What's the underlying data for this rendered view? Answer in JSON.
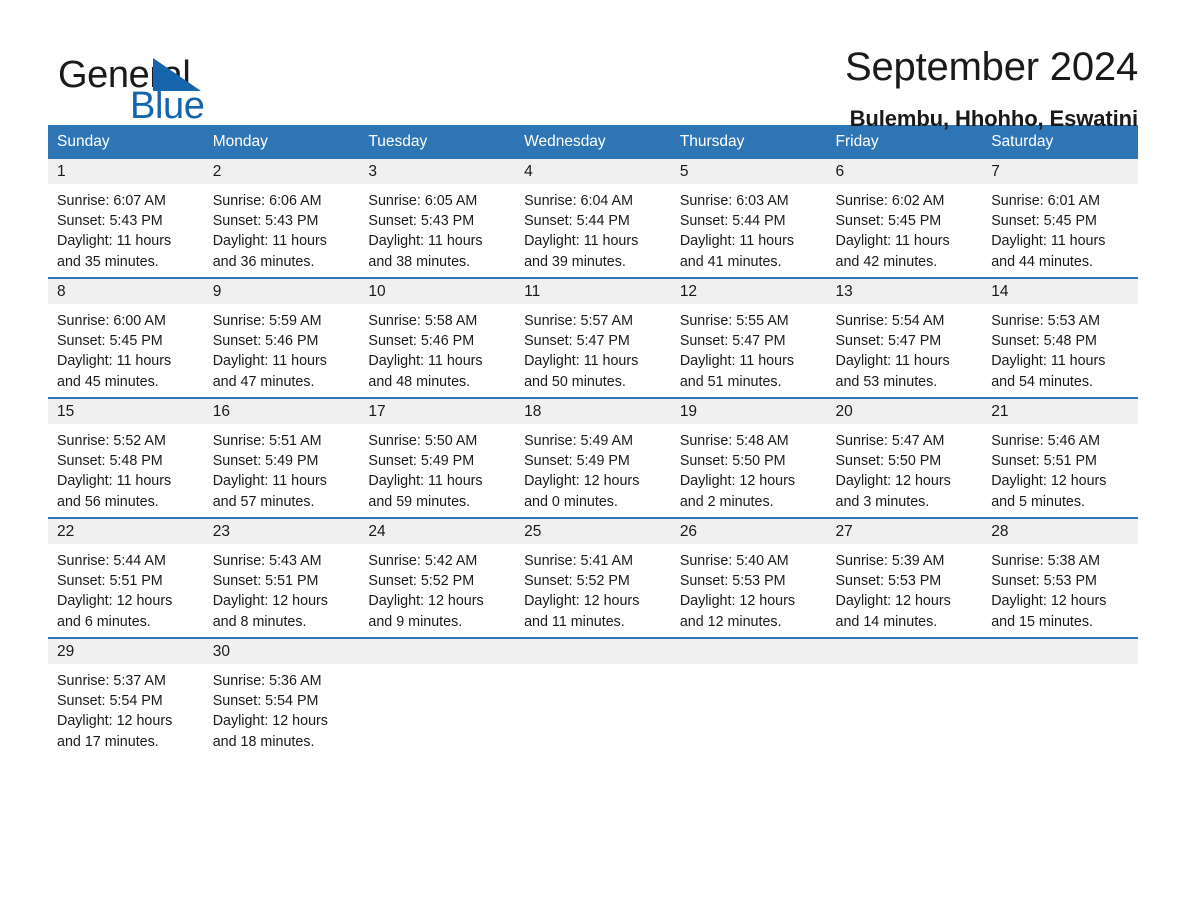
{
  "brand": {
    "name_part1": "General",
    "name_part2": "Blue",
    "accent_color": "#1565ad"
  },
  "header": {
    "title": "September 2024",
    "subtitle": "Bulembu, Hhohho, Eswatini"
  },
  "theme": {
    "header_bg": "#2e75b6",
    "daynum_bg": "#f0f0f0",
    "row_border": "#2e75b6"
  },
  "calendar": {
    "weekday_headers": [
      "Sunday",
      "Monday",
      "Tuesday",
      "Wednesday",
      "Thursday",
      "Friday",
      "Saturday"
    ],
    "weeks": [
      [
        {
          "day": "1",
          "sunrise": "Sunrise: 6:07 AM",
          "sunset": "Sunset: 5:43 PM",
          "daylight": "Daylight: 11 hours and 35 minutes."
        },
        {
          "day": "2",
          "sunrise": "Sunrise: 6:06 AM",
          "sunset": "Sunset: 5:43 PM",
          "daylight": "Daylight: 11 hours and 36 minutes."
        },
        {
          "day": "3",
          "sunrise": "Sunrise: 6:05 AM",
          "sunset": "Sunset: 5:43 PM",
          "daylight": "Daylight: 11 hours and 38 minutes."
        },
        {
          "day": "4",
          "sunrise": "Sunrise: 6:04 AM",
          "sunset": "Sunset: 5:44 PM",
          "daylight": "Daylight: 11 hours and 39 minutes."
        },
        {
          "day": "5",
          "sunrise": "Sunrise: 6:03 AM",
          "sunset": "Sunset: 5:44 PM",
          "daylight": "Daylight: 11 hours and 41 minutes."
        },
        {
          "day": "6",
          "sunrise": "Sunrise: 6:02 AM",
          "sunset": "Sunset: 5:45 PM",
          "daylight": "Daylight: 11 hours and 42 minutes."
        },
        {
          "day": "7",
          "sunrise": "Sunrise: 6:01 AM",
          "sunset": "Sunset: 5:45 PM",
          "daylight": "Daylight: 11 hours and 44 minutes."
        }
      ],
      [
        {
          "day": "8",
          "sunrise": "Sunrise: 6:00 AM",
          "sunset": "Sunset: 5:45 PM",
          "daylight": "Daylight: 11 hours and 45 minutes."
        },
        {
          "day": "9",
          "sunrise": "Sunrise: 5:59 AM",
          "sunset": "Sunset: 5:46 PM",
          "daylight": "Daylight: 11 hours and 47 minutes."
        },
        {
          "day": "10",
          "sunrise": "Sunrise: 5:58 AM",
          "sunset": "Sunset: 5:46 PM",
          "daylight": "Daylight: 11 hours and 48 minutes."
        },
        {
          "day": "11",
          "sunrise": "Sunrise: 5:57 AM",
          "sunset": "Sunset: 5:47 PM",
          "daylight": "Daylight: 11 hours and 50 minutes."
        },
        {
          "day": "12",
          "sunrise": "Sunrise: 5:55 AM",
          "sunset": "Sunset: 5:47 PM",
          "daylight": "Daylight: 11 hours and 51 minutes."
        },
        {
          "day": "13",
          "sunrise": "Sunrise: 5:54 AM",
          "sunset": "Sunset: 5:47 PM",
          "daylight": "Daylight: 11 hours and 53 minutes."
        },
        {
          "day": "14",
          "sunrise": "Sunrise: 5:53 AM",
          "sunset": "Sunset: 5:48 PM",
          "daylight": "Daylight: 11 hours and 54 minutes."
        }
      ],
      [
        {
          "day": "15",
          "sunrise": "Sunrise: 5:52 AM",
          "sunset": "Sunset: 5:48 PM",
          "daylight": "Daylight: 11 hours and 56 minutes."
        },
        {
          "day": "16",
          "sunrise": "Sunrise: 5:51 AM",
          "sunset": "Sunset: 5:49 PM",
          "daylight": "Daylight: 11 hours and 57 minutes."
        },
        {
          "day": "17",
          "sunrise": "Sunrise: 5:50 AM",
          "sunset": "Sunset: 5:49 PM",
          "daylight": "Daylight: 11 hours and 59 minutes."
        },
        {
          "day": "18",
          "sunrise": "Sunrise: 5:49 AM",
          "sunset": "Sunset: 5:49 PM",
          "daylight": "Daylight: 12 hours and 0 minutes."
        },
        {
          "day": "19",
          "sunrise": "Sunrise: 5:48 AM",
          "sunset": "Sunset: 5:50 PM",
          "daylight": "Daylight: 12 hours and 2 minutes."
        },
        {
          "day": "20",
          "sunrise": "Sunrise: 5:47 AM",
          "sunset": "Sunset: 5:50 PM",
          "daylight": "Daylight: 12 hours and 3 minutes."
        },
        {
          "day": "21",
          "sunrise": "Sunrise: 5:46 AM",
          "sunset": "Sunset: 5:51 PM",
          "daylight": "Daylight: 12 hours and 5 minutes."
        }
      ],
      [
        {
          "day": "22",
          "sunrise": "Sunrise: 5:44 AM",
          "sunset": "Sunset: 5:51 PM",
          "daylight": "Daylight: 12 hours and 6 minutes."
        },
        {
          "day": "23",
          "sunrise": "Sunrise: 5:43 AM",
          "sunset": "Sunset: 5:51 PM",
          "daylight": "Daylight: 12 hours and 8 minutes."
        },
        {
          "day": "24",
          "sunrise": "Sunrise: 5:42 AM",
          "sunset": "Sunset: 5:52 PM",
          "daylight": "Daylight: 12 hours and 9 minutes."
        },
        {
          "day": "25",
          "sunrise": "Sunrise: 5:41 AM",
          "sunset": "Sunset: 5:52 PM",
          "daylight": "Daylight: 12 hours and 11 minutes."
        },
        {
          "day": "26",
          "sunrise": "Sunrise: 5:40 AM",
          "sunset": "Sunset: 5:53 PM",
          "daylight": "Daylight: 12 hours and 12 minutes."
        },
        {
          "day": "27",
          "sunrise": "Sunrise: 5:39 AM",
          "sunset": "Sunset: 5:53 PM",
          "daylight": "Daylight: 12 hours and 14 minutes."
        },
        {
          "day": "28",
          "sunrise": "Sunrise: 5:38 AM",
          "sunset": "Sunset: 5:53 PM",
          "daylight": "Daylight: 12 hours and 15 minutes."
        }
      ],
      [
        {
          "day": "29",
          "sunrise": "Sunrise: 5:37 AM",
          "sunset": "Sunset: 5:54 PM",
          "daylight": "Daylight: 12 hours and 17 minutes."
        },
        {
          "day": "30",
          "sunrise": "Sunrise: 5:36 AM",
          "sunset": "Sunset: 5:54 PM",
          "daylight": "Daylight: 12 hours and 18 minutes."
        },
        {
          "day": "",
          "sunrise": "",
          "sunset": "",
          "daylight": ""
        },
        {
          "day": "",
          "sunrise": "",
          "sunset": "",
          "daylight": ""
        },
        {
          "day": "",
          "sunrise": "",
          "sunset": "",
          "daylight": ""
        },
        {
          "day": "",
          "sunrise": "",
          "sunset": "",
          "daylight": ""
        },
        {
          "day": "",
          "sunrise": "",
          "sunset": "",
          "daylight": ""
        }
      ]
    ]
  }
}
